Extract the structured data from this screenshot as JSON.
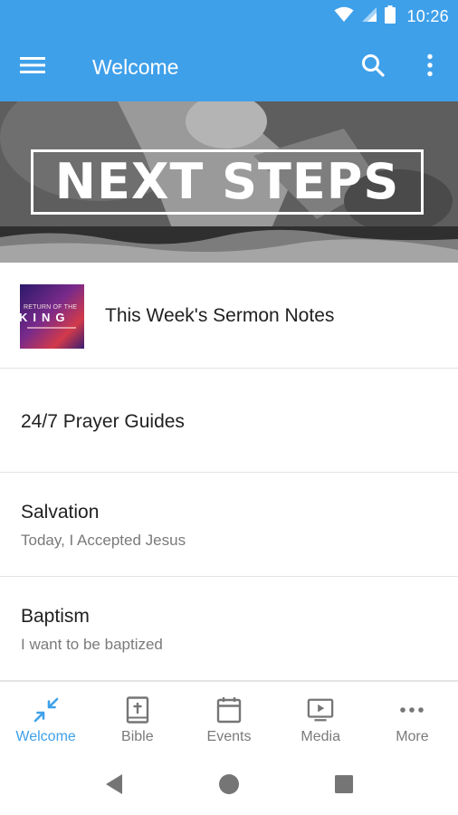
{
  "status_bar": {
    "time": "10:26"
  },
  "app_bar": {
    "title": "Welcome"
  },
  "hero": {
    "title": "NEXT STEPS"
  },
  "list": {
    "items": [
      {
        "title": "This Week's Sermon Notes",
        "subtitle": "",
        "thumb_top": "RETURN OF THE",
        "thumb_main": "KING"
      },
      {
        "title": "24/7 Prayer Guides",
        "subtitle": ""
      },
      {
        "title": "Salvation",
        "subtitle": "Today, I Accepted Jesus"
      },
      {
        "title": "Baptism",
        "subtitle": "I want to be baptized"
      }
    ]
  },
  "bottom_nav": {
    "items": [
      {
        "label": "Welcome",
        "icon": "collapse-arrows-icon",
        "active": true
      },
      {
        "label": "Bible",
        "icon": "bible-icon",
        "active": false
      },
      {
        "label": "Events",
        "icon": "calendar-icon",
        "active": false
      },
      {
        "label": "Media",
        "icon": "media-play-icon",
        "active": false
      },
      {
        "label": "More",
        "icon": "more-dots-icon",
        "active": false
      }
    ]
  },
  "colors": {
    "primary": "#3fa0ea",
    "text": "#212121",
    "secondary_text": "#7a7a7a",
    "inactive_icon": "#757575"
  }
}
